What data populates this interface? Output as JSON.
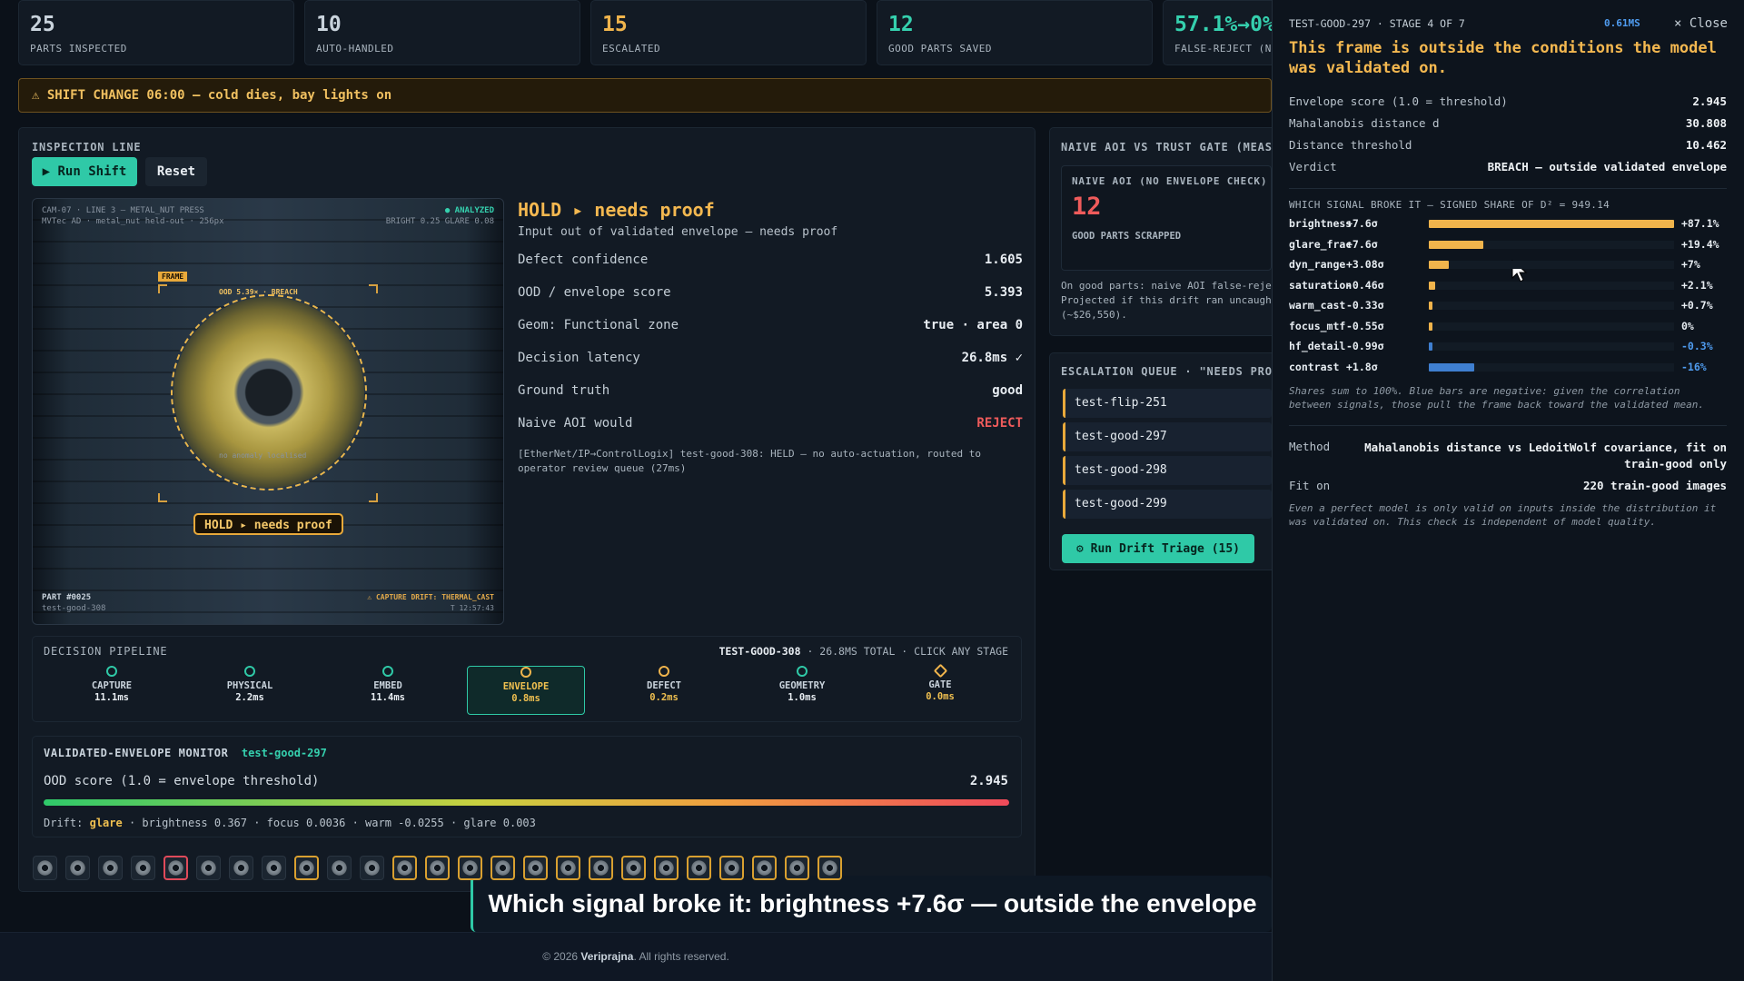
{
  "kpis": [
    {
      "value": "25",
      "label": "PARTS INSPECTED",
      "color": "#e8edf2"
    },
    {
      "value": "10",
      "label": "AUTO-HANDLED",
      "color": "#e8edf2"
    },
    {
      "value": "15",
      "label": "ESCALATED",
      "color": "#f0b44c"
    },
    {
      "value": "12",
      "label": "GOOD PARTS SAVED",
      "color": "#35d0ae"
    },
    {
      "value": "57.1%→0%",
      "label": "FALSE-REJECT (NA",
      "color": "#35d0ae"
    }
  ],
  "banner": "⚠ SHIFT CHANGE 06:00 — cold dies, bay lights on",
  "inspection": {
    "title": "INSPECTION LINE",
    "run_label": "▶ Run Shift",
    "reset_label": "Reset",
    "camera_line1": "CAM-07 · LINE 3 — METAL_NUT PRESS",
    "camera_line2": "MVTec AD · metal_nut held-out · 256px",
    "analyzed": "● ANALYZED",
    "bright_glare": "BRIGHT 0.25  GLARE 0.08",
    "frame_tag": "FRAME",
    "ood_tag": "OOD 5.39× · BREACH",
    "no_anomaly": "no anomaly localised",
    "hold_badge": "HOLD ▸ needs proof",
    "part_no": "PART #0025",
    "part_id": "test-good-308",
    "capture_drift": "⚠ CAPTURE DRIFT: THERMAL_CAST",
    "time": "T 12:57:43"
  },
  "decision": {
    "title": "HOLD ▸ needs proof",
    "subtitle": "Input out of validated envelope — needs proof",
    "rows": [
      {
        "k": "Defect confidence",
        "v": "1.605",
        "c": "#e8edf2"
      },
      {
        "k": "OOD / envelope score",
        "v": "5.393",
        "c": "#e8edf2"
      },
      {
        "k": "Geom: Functional zone",
        "v": "true · area 0",
        "c": "#e8edf2"
      },
      {
        "k": "Decision latency",
        "v": "26.8ms ✓",
        "c": "#e8edf2"
      },
      {
        "k": "Ground truth",
        "v": "good",
        "c": "#e8edf2"
      },
      {
        "k": "Naive AOI would",
        "v": "REJECT",
        "c": "#ef5b5b"
      }
    ],
    "log": "[EtherNet/IP→ControlLogix] test-good-308: HELD — no auto-actuation, routed to operator review queue (27ms)"
  },
  "pipeline": {
    "title": "DECISION PIPELINE",
    "part": "TEST-GOOD-308",
    "meta": " · 26.8MS TOTAL · CLICK ANY STAGE",
    "stages": [
      {
        "name": "CAPTURE",
        "ms": "11.1ms",
        "color": "#2fc9a7"
      },
      {
        "name": "PHYSICAL",
        "ms": "2.2ms",
        "color": "#2fc9a7"
      },
      {
        "name": "EMBED",
        "ms": "11.4ms",
        "color": "#2fc9a7"
      },
      {
        "name": "ENVELOPE",
        "ms": "0.8ms",
        "color": "#f0b44c"
      },
      {
        "name": "DEFECT",
        "ms": "0.2ms",
        "color": "#f0b44c"
      },
      {
        "name": "GEOMETRY",
        "ms": "1.0ms",
        "color": "#2fc9a7"
      },
      {
        "name": "GATE",
        "ms": "0.0ms",
        "color": "#f0b44c"
      }
    ]
  },
  "envelope": {
    "title": "VALIDATED-ENVELOPE MONITOR",
    "part": "test-good-297",
    "score_label": "OOD score (1.0 = envelope threshold)",
    "score": "2.945",
    "drift_label": "Drift:",
    "drift_key": "glare",
    "drift_rest": " · brightness 0.367 · focus 0.0036 · warm -0.0255 · glare 0.003"
  },
  "naive": {
    "title": "NAIVE AOI VS TRUST GATE (MEASU",
    "box_title": "NAIVE AOI (NO ENVELOPE CHECK)",
    "count": "12",
    "count_label": "GOOD PARTS SCRAPPED",
    "text1": "On good parts: naive AOI false-reje",
    "text2": "Projected if this drift ran uncaugh",
    "text3": "(~$26,550)."
  },
  "queue": {
    "title": "ESCALATION QUEUE · \"NEEDS PROO",
    "items": [
      "test-flip-251",
      "test-good-297",
      "test-good-298",
      "test-good-299"
    ],
    "triage_label": "⚙ Run Drift Triage (15)"
  },
  "caption": "Which signal broke it: brightness +7.6σ — outside the envelope",
  "footer": {
    "prefix": "© 2026 ",
    "brand": "Veriprajna",
    "suffix": ". All rights reserved."
  },
  "side": {
    "stage": "TEST-GOOD-297 · STAGE 4 OF 7",
    "latency": "0.61MS",
    "close_label": "× Close",
    "headline": "This frame is outside the conditions the model was validated on.",
    "stats": [
      {
        "k": "Envelope score (1.0 = threshold)",
        "v": "2.945"
      },
      {
        "k": "Mahalanobis distance d",
        "v": "30.808"
      },
      {
        "k": "Distance threshold",
        "v": "10.462"
      },
      {
        "k": "Verdict",
        "v": "BREACH — outside validated envelope"
      }
    ],
    "signals_title": "WHICH SIGNAL BROKE IT — SIGNED SHARE OF D² = 949.14",
    "signals": [
      {
        "name": "brightness",
        "sigma": "+7.6σ",
        "pct": "+87.1%",
        "share": 87.1,
        "color": "#f0b44c"
      },
      {
        "name": "glare_frac",
        "sigma": "+7.6σ",
        "pct": "+19.4%",
        "share": 19.4,
        "color": "#f0b44c"
      },
      {
        "name": "dyn_range",
        "sigma": "+3.08σ",
        "pct": "+7%",
        "share": 7,
        "color": "#f0b44c"
      },
      {
        "name": "saturation",
        "sigma": "-0.46σ",
        "pct": "+2.1%",
        "share": 2.1,
        "color": "#f0b44c"
      },
      {
        "name": "warm_cast",
        "sigma": "-0.33σ",
        "pct": "+0.7%",
        "share": 0.7,
        "color": "#f0b44c"
      },
      {
        "name": "focus_mtf",
        "sigma": "-0.55σ",
        "pct": "0%",
        "share": 1,
        "color": "#f0b44c"
      },
      {
        "name": "hf_detail",
        "sigma": "-0.99σ",
        "pct": "-0.3%",
        "share": 0.3,
        "color": "#3f7fd0"
      },
      {
        "name": "contrast",
        "sigma": "+1.8σ",
        "pct": "-16%",
        "share": 16,
        "color": "#3f7fd0"
      }
    ],
    "shares_note": "Shares sum to 100%. Blue bars are negative: given the correlation between signals, those pull the frame back toward the validated mean.",
    "method_k": "Method",
    "method_v": "Mahalanobis distance vs LedoitWolf covariance, fit on train-good only",
    "fit_k": "Fit on",
    "fit_v": "220 train-good images",
    "footnote": "Even a perfect model is only valid on inputs inside the distribution it was validated on. This check is independent of model quality."
  }
}
